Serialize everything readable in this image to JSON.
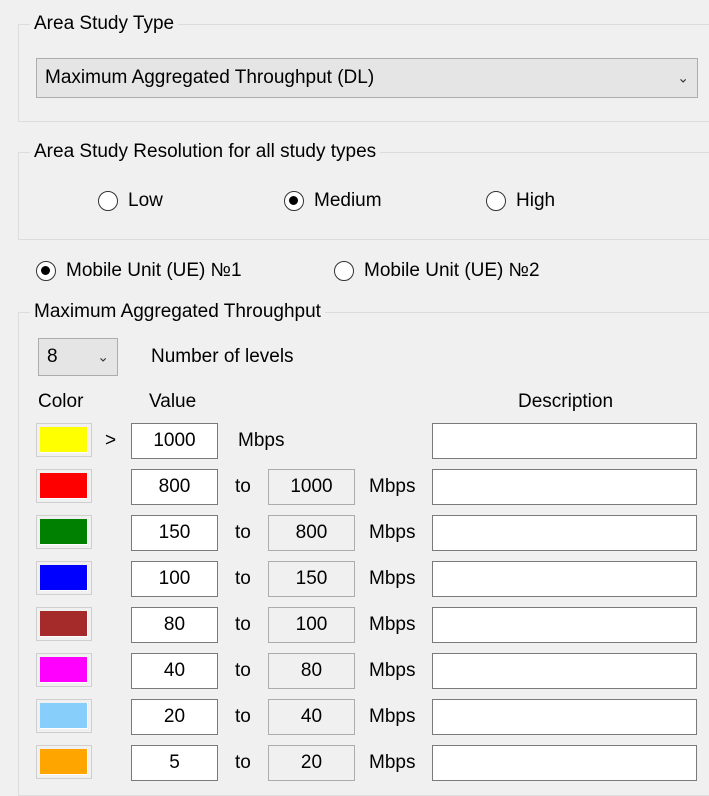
{
  "area_study_type": {
    "legend": "Area Study Type",
    "selected": "Maximum Aggregated Throughput (DL)"
  },
  "resolution": {
    "legend": "Area Study Resolution for all study types",
    "options": [
      {
        "label": "Low",
        "checked": false
      },
      {
        "label": "Medium",
        "checked": true
      },
      {
        "label": "High",
        "checked": false
      }
    ]
  },
  "mobile_units": [
    {
      "label": "Mobile Unit (UE) №1",
      "checked": true
    },
    {
      "label": "Mobile Unit (UE) №2",
      "checked": false
    }
  ],
  "throughput": {
    "legend": "Maximum Aggregated Throughput",
    "levels_count": "8",
    "levels_label": "Number of levels",
    "col_color": "Color",
    "col_value": "Value",
    "col_description": "Description",
    "gt_symbol": ">",
    "to_label": "to",
    "unit": "Mbps",
    "rows": [
      {
        "color": "#ffff00",
        "from": "1000",
        "to": "",
        "description": ""
      },
      {
        "color": "#ff0000",
        "from": "800",
        "to": "1000",
        "description": ""
      },
      {
        "color": "#008000",
        "from": "150",
        "to": "800",
        "description": ""
      },
      {
        "color": "#0000ff",
        "from": "100",
        "to": "150",
        "description": ""
      },
      {
        "color": "#a52a2a",
        "from": "80",
        "to": "100",
        "description": ""
      },
      {
        "color": "#ff00ff",
        "from": "40",
        "to": "80",
        "description": ""
      },
      {
        "color": "#87cefa",
        "from": "20",
        "to": "40",
        "description": ""
      },
      {
        "color": "#ffa500",
        "from": "5",
        "to": "20",
        "description": ""
      }
    ]
  },
  "icons": {
    "dropdown": "chevron-down-icon"
  }
}
